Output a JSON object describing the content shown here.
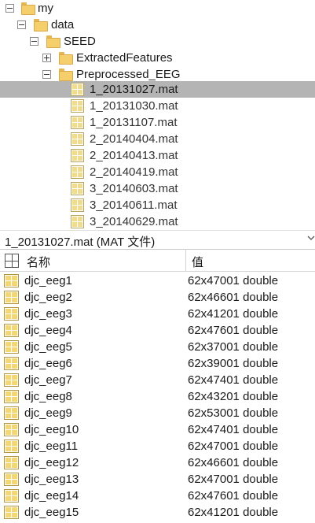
{
  "tree": {
    "items": [
      {
        "label": "my",
        "kind": "folder",
        "toggle": "minus"
      },
      {
        "label": "data",
        "kind": "folder",
        "toggle": "minus"
      },
      {
        "label": "SEED",
        "kind": "folder",
        "toggle": "minus"
      },
      {
        "label": "ExtractedFeatures",
        "kind": "folder",
        "toggle": "plus"
      },
      {
        "label": "Preprocessed_EEG",
        "kind": "folder",
        "toggle": "minus"
      },
      {
        "label": "1_20131027.mat",
        "kind": "mat-file",
        "selected": true
      },
      {
        "label": "1_20131030.mat",
        "kind": "mat-file"
      },
      {
        "label": "1_20131107.mat",
        "kind": "mat-file"
      },
      {
        "label": "2_20140404.mat",
        "kind": "mat-file"
      },
      {
        "label": "2_20140413.mat",
        "kind": "mat-file"
      },
      {
        "label": "2_20140419.mat",
        "kind": "mat-file"
      },
      {
        "label": "3_20140603.mat",
        "kind": "mat-file"
      },
      {
        "label": "3_20140611.mat",
        "kind": "mat-file"
      },
      {
        "label": "3_20140629.mat",
        "kind": "mat-file"
      }
    ]
  },
  "details": {
    "title": "1_20131027.mat  (MAT 文件)",
    "columns": {
      "name": "名称",
      "value": "值"
    },
    "variables": [
      {
        "name": "djc_eeg1",
        "value": "62x47001 double"
      },
      {
        "name": "djc_eeg2",
        "value": "62x46601 double"
      },
      {
        "name": "djc_eeg3",
        "value": "62x41201 double"
      },
      {
        "name": "djc_eeg4",
        "value": "62x47601 double"
      },
      {
        "name": "djc_eeg5",
        "value": "62x37001 double"
      },
      {
        "name": "djc_eeg6",
        "value": "62x39001 double"
      },
      {
        "name": "djc_eeg7",
        "value": "62x47401 double"
      },
      {
        "name": "djc_eeg8",
        "value": "62x43201 double"
      },
      {
        "name": "djc_eeg9",
        "value": "62x53001 double"
      },
      {
        "name": "djc_eeg10",
        "value": "62x47401 double"
      },
      {
        "name": "djc_eeg11",
        "value": "62x47001 double"
      },
      {
        "name": "djc_eeg12",
        "value": "62x46601 double"
      },
      {
        "name": "djc_eeg13",
        "value": "62x47001 double"
      },
      {
        "name": "djc_eeg14",
        "value": "62x47601 double"
      },
      {
        "name": "djc_eeg15",
        "value": "62x41201 double"
      }
    ]
  },
  "icons": {
    "folder": "folder-icon",
    "mat_file": "mat-file-icon",
    "variable": "matrix-variable-icon",
    "header_column": "grid-icon",
    "collapse": "chevron-down-icon"
  },
  "colors": {
    "selection": "#b4b4b4",
    "folder": "#f5cf6c",
    "variable_icon": "#f2d774"
  }
}
